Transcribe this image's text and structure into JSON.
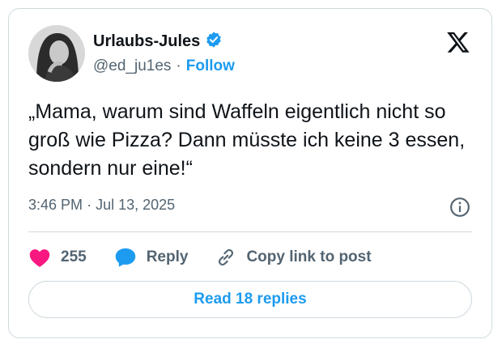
{
  "user": {
    "display_name": "Urlaubs-Jules",
    "handle": "@ed_ju1es",
    "separator": "·",
    "follow_label": "Follow",
    "verified_icon": "verified-badge-icon"
  },
  "tweet": {
    "text": "„Mama, warum sind Waffeln eigentlich nicht so groß wie Pizza? Dann müsste ich keine 3 essen, sondern nur eine!“",
    "time": "3:46 PM",
    "separator": "·",
    "date": "Jul 13, 2025"
  },
  "actions": {
    "like_count": "255",
    "reply_label": "Reply",
    "copy_label": "Copy link to post",
    "read_replies_label": "Read 18 replies"
  },
  "colors": {
    "accent": "#1d9bf0",
    "like": "#f91880",
    "text": "#0f1419",
    "muted": "#536471",
    "border": "#cfd9de"
  }
}
